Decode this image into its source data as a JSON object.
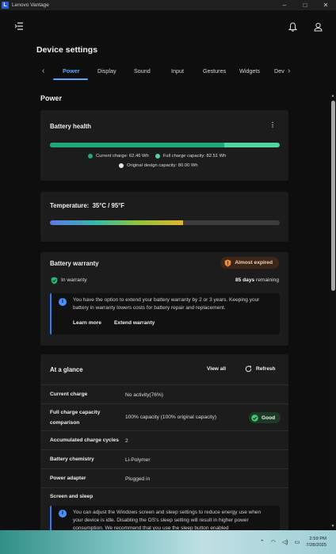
{
  "window": {
    "app_title": "Lenovo Vantage",
    "logo_letter": "L"
  },
  "page": {
    "title": "Device settings"
  },
  "tabs": [
    "Power",
    "Display",
    "Sound",
    "Input",
    "Gestures",
    "Widgets",
    "Dev"
  ],
  "section_title": "Power",
  "battery_health": {
    "title": "Battery health",
    "current_charge_label": "Current charge:",
    "current_charge_value": "62.46 Wh",
    "full_charge_label": "Full charge capacity:",
    "full_charge_value": "82.51 Wh",
    "design_capacity_label": "Original design capacity:",
    "design_capacity_value": "80.00 Wh",
    "current_wh": 62.46,
    "full_wh": 82.51,
    "design_wh": 80.0,
    "colors": {
      "current": "#1fa97a",
      "full": "#52d4a0",
      "design": "#e6e6e6"
    }
  },
  "temperature": {
    "label": "Temperature:",
    "value": "35°C / 95°F",
    "level_fraction": 0.58
  },
  "warranty": {
    "title": "Battery warranty",
    "badge": "Almost expired",
    "status": "In warranty",
    "days": "85 days",
    "days_suffix": "remaining",
    "info_text": "You have the option to extend your battery warranty by 2 or 3 years. Keeping your battery in warranty lowers costs for battery repair and replacement.",
    "learn_more": "Learn more",
    "extend": "Extend warranty"
  },
  "glance": {
    "title": "At a glance",
    "view_all": "View all",
    "refresh": "Refresh",
    "rows": [
      {
        "label": "Current charge",
        "value": "No activity(76%)"
      },
      {
        "label": "Full charge capacity comparison",
        "value": "100% capacity (100% original capacity)",
        "badge": "Good"
      },
      {
        "label": "Accumulated charge cycles",
        "value": "2"
      },
      {
        "label": "Battery chemistry",
        "value": "Li-Polymer"
      },
      {
        "label": "Power adapter",
        "value": "Plugged in"
      }
    ],
    "screen_sleep_label": "Screen and sleep",
    "screen_sleep_info": "You can adjust the Windows screen and sleep settings to reduce energy use when your device is idle. Disabling the OS's sleep setting will result in higher power consumption. We recommend that you use the sleep button enabled"
  },
  "taskbar": {
    "time": "2:59 PM",
    "date": "7/28/2025"
  },
  "accent": "#5aa9ff"
}
